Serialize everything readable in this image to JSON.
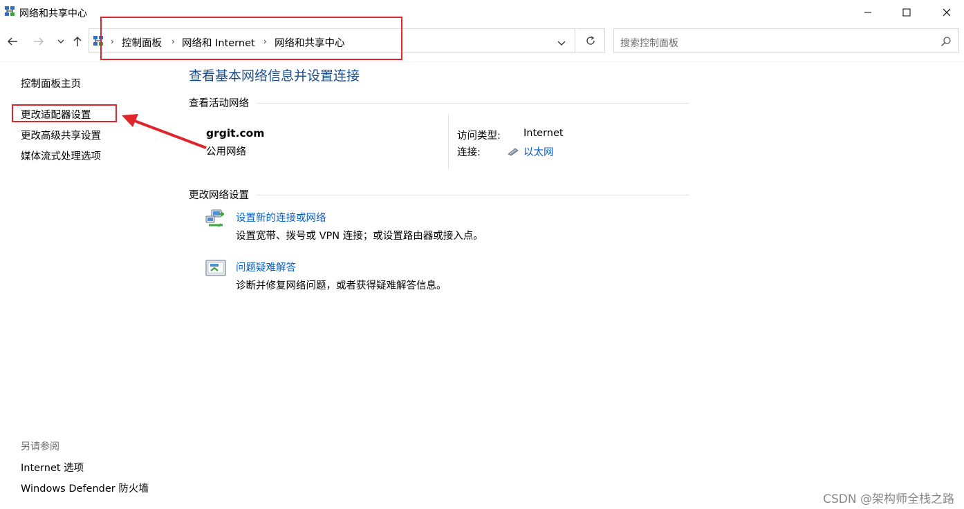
{
  "window": {
    "title": "网络和共享中心",
    "controls": [
      "minimize",
      "maximize",
      "close"
    ]
  },
  "nav": {
    "icons": [
      "back-arrow-icon",
      "forward-arrow-icon",
      "recent-dropdown-icon",
      "up-arrow-icon"
    ]
  },
  "address": {
    "crumbs": [
      "控制面板",
      "网络和 Internet",
      "网络和共享中心"
    ]
  },
  "search": {
    "placeholder": "搜索控制面板"
  },
  "sidebar": {
    "items": [
      {
        "label": "控制面板主页"
      },
      {
        "label": "更改适配器设置"
      },
      {
        "label": "更改高级共享设置"
      },
      {
        "label": "媒体流式处理选项"
      }
    ],
    "see_also_title": "另请参阅",
    "see_also": [
      {
        "label": "Internet 选项"
      },
      {
        "label": "Windows Defender 防火墙"
      }
    ]
  },
  "main": {
    "heading": "查看基本网络信息并设置连接",
    "active_section": "查看活动网络",
    "network": {
      "name": "grgit.com",
      "type": "公用网络",
      "access_label": "访问类型:",
      "access_value": "Internet",
      "conn_label": "连接:",
      "conn_value": "以太网"
    },
    "change_section": "更改网络设置",
    "tasks": [
      {
        "title": "设置新的连接或网络",
        "desc": "设置宽带、拨号或 VPN 连接；或设置路由器或接入点。",
        "icon": "network-setup-icon"
      },
      {
        "title": "问题疑难解答",
        "desc": "诊断并修复网络问题，或者获得疑难解答信息。",
        "icon": "troubleshoot-icon"
      }
    ]
  },
  "watermark": "CSDN @架构师全栈之路",
  "colors": {
    "link": "#0a5fc0",
    "heading": "#1e4e8c",
    "annotation": "#e0242c"
  }
}
